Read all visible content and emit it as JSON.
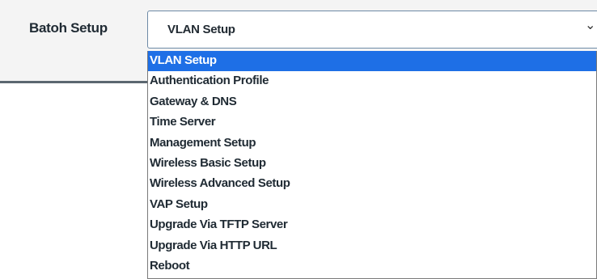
{
  "label": "Batoh Setup",
  "select": {
    "value": "VLAN Setup",
    "arrow_icon": "chevron-down-icon"
  },
  "options": [
    {
      "label": "VLAN Setup",
      "selected": true
    },
    {
      "label": "Authentication Profile",
      "selected": false
    },
    {
      "label": "Gateway & DNS",
      "selected": false
    },
    {
      "label": "Time Server",
      "selected": false
    },
    {
      "label": "Management Setup",
      "selected": false
    },
    {
      "label": "Wireless Basic Setup",
      "selected": false
    },
    {
      "label": "Wireless Advanced Setup",
      "selected": false
    },
    {
      "label": "VAP Setup",
      "selected": false
    },
    {
      "label": "Upgrade Via TFTP Server",
      "selected": false
    },
    {
      "label": "Upgrade Via HTTP URL",
      "selected": false
    },
    {
      "label": "Reboot",
      "selected": false
    }
  ],
  "colors": {
    "highlight": "#1e6fe6",
    "panel_bg": "#f4f4f4",
    "select_border": "#6d8aa6"
  }
}
